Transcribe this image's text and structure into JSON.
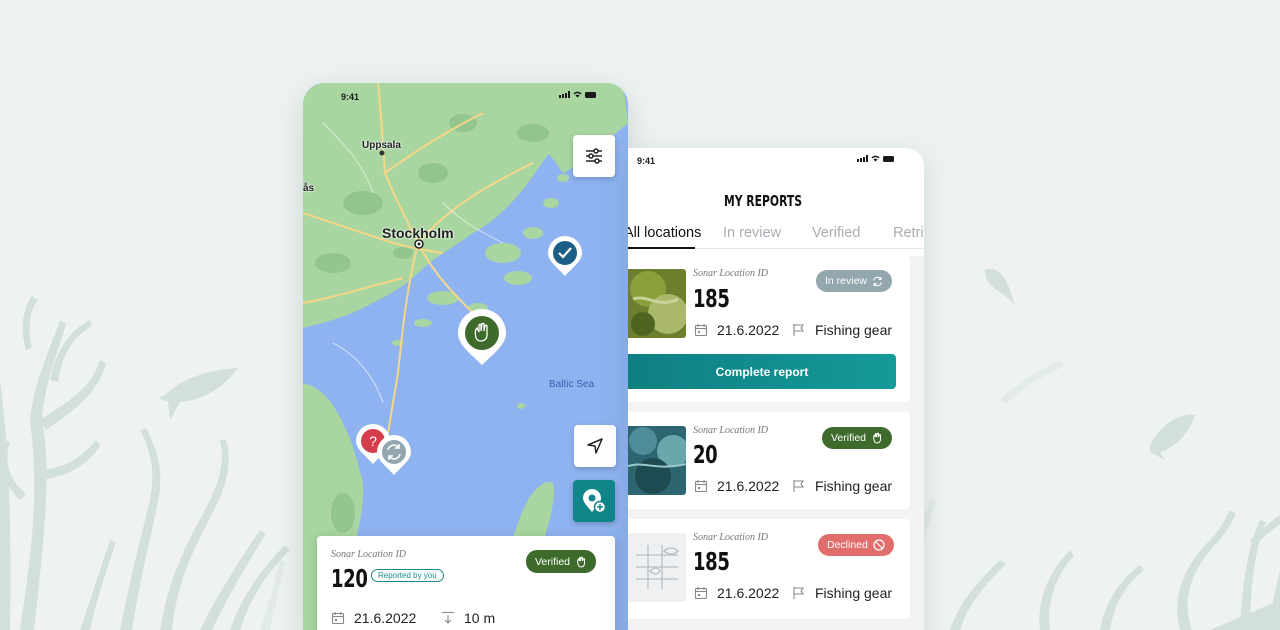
{
  "map_screen": {
    "status_time": "9:41",
    "labels": {
      "uppsala": "Uppsala",
      "stockholm": "Stockholm",
      "baltic_sea": "Baltic Sea",
      "edge": "ås"
    },
    "card": {
      "id_label": "Sonar Location ID",
      "id": "120",
      "reported_badge": "Reported by you",
      "status": "Verified",
      "date": "21.6.2022",
      "depth": "10 m"
    }
  },
  "reports_screen": {
    "status_time": "9:41",
    "title": "MY REPORTS",
    "tabs": [
      "All locations",
      "In review",
      "Verified",
      "Retrieved"
    ],
    "reports": [
      {
        "id_label": "Sonar Location ID",
        "id": "185",
        "status": "In review",
        "date": "21.6.2022",
        "category": "Fishing gear",
        "action": "Complete report"
      },
      {
        "id_label": "Sonar Location ID",
        "id": "20",
        "status": "Verified",
        "date": "21.6.2022",
        "category": "Fishing gear"
      },
      {
        "id_label": "Sonar Location ID",
        "id": "185",
        "status": "Declined",
        "date": "21.6.2022",
        "category": "Fishing gear"
      }
    ]
  },
  "colors": {
    "background": "#eef3f2",
    "sea": "#8fb3f0",
    "land": "#a8d5a0",
    "accent_teal": "#11868a",
    "verified": "#3e6b2c",
    "in_review": "#93a7ae",
    "declined": "#e26d6d"
  },
  "icons": [
    "filter-icon",
    "navigate-icon",
    "add-location-icon",
    "check-pin-icon",
    "hand-pin-icon",
    "question-pin-icon",
    "refresh-pin-icon",
    "calendar-icon",
    "depth-icon",
    "flag-icon",
    "refresh-icon",
    "hand-icon",
    "blocked-icon",
    "fish-icon",
    "coral-icon"
  ]
}
